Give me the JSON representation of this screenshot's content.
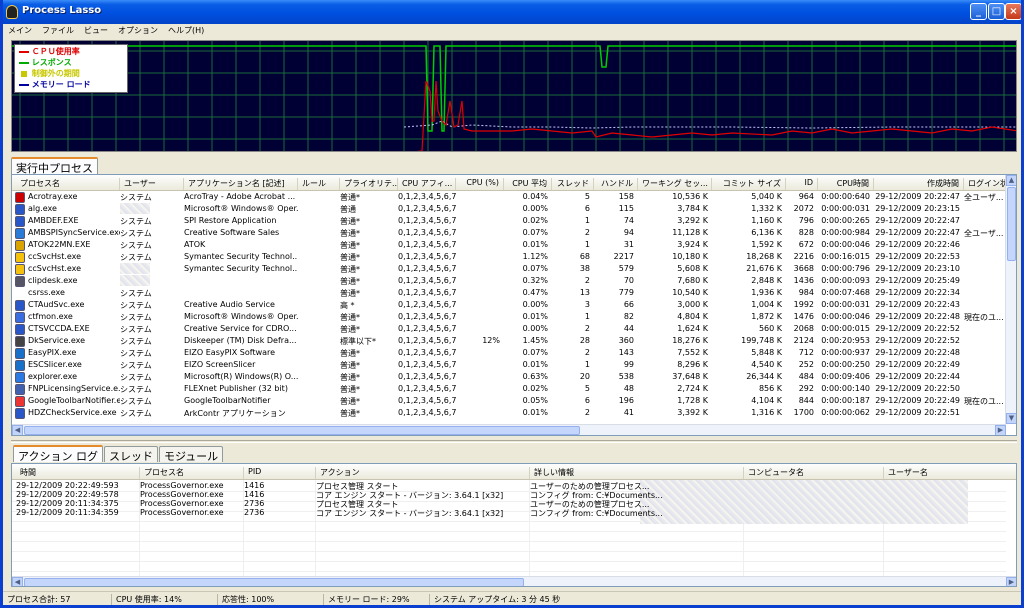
{
  "window": {
    "title": "Process Lasso"
  },
  "menu": [
    "メイン",
    "ファイル",
    "ビュー",
    "オプション",
    "ヘルプ(H)"
  ],
  "colors": {
    "cpu": "#e00000",
    "response": "#00cc00",
    "restraint": "#d0d000",
    "memory": "#3030ff",
    "graph_bg": "#000035",
    "grid": "#1a6a3a"
  },
  "graph": {
    "legend": [
      {
        "label": "ＣＰＵ使用率",
        "color": "#e00000",
        "icon": "solid-line-icon"
      },
      {
        "label": "レスポンス",
        "color": "#00aa00",
        "icon": "solid-line-icon"
      },
      {
        "label": "制御外の期間",
        "color": "#c8c800",
        "icon": "square-icon"
      },
      {
        "label": "メモリー ロード",
        "color": "#0000a0",
        "icon": "dashed-line-icon"
      }
    ]
  },
  "process_tab": "実行中プロセス",
  "process_columns": [
    "プロセス名",
    "ユーザー",
    "アプリケーション名 [記述]",
    "ルール",
    "プライオリテ...",
    "CPU アフィ...",
    "CPU (%)",
    "CPU 平均",
    "スレッド",
    "ハンドル",
    "ワーキング セッ...",
    "コミット サイズ",
    "ID",
    "CPU時間",
    "作成時間",
    "ログイン状"
  ],
  "processes": [
    {
      "name": "Acrotray.exe",
      "icon": "acrobat-icon",
      "user": "システム",
      "app": "AcroTray - Adobe Acrobat ...",
      "rule": "",
      "priority": "普通*",
      "affinity": "0,1,2,3,4,5,6,7",
      "cpu": "",
      "cpu_avg": "0.04%",
      "threads": "5",
      "handles": "158",
      "working_set": "10,536 K",
      "commit": "5,040 K",
      "id": "964",
      "cpu_time": "0:00:00:640",
      "created": "29-12/2009 20:22:47",
      "login": "全ユーザ..."
    },
    {
      "name": "alg.exe",
      "icon": "app-icon",
      "user": "",
      "app": "Microsoft® Windows® Oper...",
      "rule": "",
      "priority": "普通",
      "affinity": "0,1,2,3,4,5,6,7",
      "cpu": "",
      "cpu_avg": "0.00%",
      "threads": "6",
      "handles": "115",
      "working_set": "3,784 K",
      "commit": "1,332 K",
      "id": "2072",
      "cpu_time": "0:00:00:031",
      "created": "29-12/2009 20:23:15",
      "login": ""
    },
    {
      "name": "AMBDEF.EXE",
      "icon": "app-icon",
      "user": "システム",
      "app": "SPI Restore Application",
      "rule": "",
      "priority": "普通*",
      "affinity": "0,1,2,3,4,5,6,7",
      "cpu": "",
      "cpu_avg": "0.02%",
      "threads": "1",
      "handles": "74",
      "working_set": "3,292 K",
      "commit": "1,160 K",
      "id": "796",
      "cpu_time": "0:00:00:265",
      "created": "29-12/2009 20:22:47",
      "login": ""
    },
    {
      "name": "AMBSPISyncService.exe",
      "icon": "globe-icon",
      "user": "システム",
      "app": "Creative Software Sales",
      "rule": "",
      "priority": "普通*",
      "affinity": "0,1,2,3,4,5,6,7",
      "cpu": "",
      "cpu_avg": "0.07%",
      "threads": "2",
      "handles": "94",
      "working_set": "11,128 K",
      "commit": "6,136 K",
      "id": "828",
      "cpu_time": "0:00:00:984",
      "created": "29-12/2009 20:22:47",
      "login": "全ユーザ..."
    },
    {
      "name": "ATOK22MN.EXE",
      "icon": "atok-icon",
      "user": "システム",
      "app": "ATOK",
      "rule": "",
      "priority": "普通*",
      "affinity": "0,1,2,3,4,5,6,7",
      "cpu": "",
      "cpu_avg": "0.01%",
      "threads": "1",
      "handles": "31",
      "working_set": "3,924 K",
      "commit": "1,592 K",
      "id": "672",
      "cpu_time": "0:00:00:046",
      "created": "29-12/2009 20:22:46",
      "login": ""
    },
    {
      "name": "ccSvcHst.exe",
      "icon": "norton-icon",
      "user": "システム",
      "app": "Symantec Security Technol...",
      "rule": "",
      "priority": "普通*",
      "affinity": "0,1,2,3,4,5,6,7",
      "cpu": "",
      "cpu_avg": "1.12%",
      "threads": "68",
      "handles": "2217",
      "working_set": "10,180 K",
      "commit": "18,268 K",
      "id": "2216",
      "cpu_time": "0:00:16:015",
      "created": "29-12/2009 20:22:53",
      "login": ""
    },
    {
      "name": "ccSvcHst.exe",
      "icon": "norton-icon",
      "user": "",
      "app": "Symantec Security Technol...",
      "rule": "",
      "priority": "普通*",
      "affinity": "0,1,2,3,4,5,6,7",
      "cpu": "",
      "cpu_avg": "0.07%",
      "threads": "38",
      "handles": "579",
      "working_set": "5,608 K",
      "commit": "21,676 K",
      "id": "3668",
      "cpu_time": "0:00:00:796",
      "created": "29-12/2009 20:23:10",
      "login": ""
    },
    {
      "name": "clipdesk.exe",
      "icon": "clip-icon",
      "user": "",
      "app": "",
      "rule": "",
      "priority": "普通*",
      "affinity": "0,1,2,3,4,5,6,7",
      "cpu": "",
      "cpu_avg": "0.32%",
      "threads": "2",
      "handles": "70",
      "working_set": "7,680 K",
      "commit": "2,848 K",
      "id": "1436",
      "cpu_time": "0:00:00:093",
      "created": "29-12/2009 20:25:49",
      "login": ""
    },
    {
      "name": "csrss.exe",
      "icon": "blank-icon",
      "user": "システム",
      "app": "",
      "rule": "",
      "priority": "普通*",
      "affinity": "0,1,2,3,4,5,6,7",
      "cpu": "",
      "cpu_avg": "0.47%",
      "threads": "13",
      "handles": "779",
      "working_set": "10,540 K",
      "commit": "1,936 K",
      "id": "984",
      "cpu_time": "0:00:07:468",
      "created": "29-12/2009 20:22:34",
      "login": ""
    },
    {
      "name": "CTAudSvc.exe",
      "icon": "app-icon",
      "user": "システム",
      "app": "Creative Audio Service",
      "rule": "",
      "priority": "高 *",
      "affinity": "0,1,2,3,4,5,6,7",
      "cpu": "",
      "cpu_avg": "0.00%",
      "threads": "3",
      "handles": "66",
      "working_set": "3,000 K",
      "commit": "1,004 K",
      "id": "1992",
      "cpu_time": "0:00:00:031",
      "created": "29-12/2009 20:22:43",
      "login": ""
    },
    {
      "name": "ctfmon.exe",
      "icon": "ctf-icon",
      "user": "システム",
      "app": "Microsoft® Windows® Oper...",
      "rule": "",
      "priority": "普通*",
      "affinity": "0,1,2,3,4,5,6,7",
      "cpu": "",
      "cpu_avg": "0.01%",
      "threads": "1",
      "handles": "82",
      "working_set": "4,804 K",
      "commit": "1,872 K",
      "id": "1476",
      "cpu_time": "0:00:00:046",
      "created": "29-12/2009 20:22:48",
      "login": "現在のユ..."
    },
    {
      "name": "CTSVCCDA.EXE",
      "icon": "app-icon",
      "user": "システム",
      "app": "Creative Service for CDRO...",
      "rule": "",
      "priority": "普通*",
      "affinity": "0,1,2,3,4,5,6,7",
      "cpu": "",
      "cpu_avg": "0.00%",
      "threads": "2",
      "handles": "44",
      "working_set": "1,624 K",
      "commit": "560 K",
      "id": "2068",
      "cpu_time": "0:00:00:015",
      "created": "29-12/2009 20:22:52",
      "login": ""
    },
    {
      "name": "DkService.exe",
      "icon": "clock-icon",
      "user": "システム",
      "app": "Diskeeper (TM) Disk Defra...",
      "rule": "",
      "priority": "標準以下*",
      "affinity": "0,1,2,3,4,5,6,7",
      "cpu": "12%",
      "cpu_avg": "1.45%",
      "threads": "28",
      "handles": "360",
      "working_set": "18,276 K",
      "commit": "199,748 K",
      "id": "2124",
      "cpu_time": "0:00:20:953",
      "created": "29-12/2009 20:22:52",
      "login": ""
    },
    {
      "name": "EasyPIX.exe",
      "icon": "eizo-icon",
      "user": "システム",
      "app": "EIZO EasyPIX Software",
      "rule": "",
      "priority": "普通*",
      "affinity": "0,1,2,3,4,5,6,7",
      "cpu": "",
      "cpu_avg": "0.07%",
      "threads": "2",
      "handles": "143",
      "working_set": "7,552 K",
      "commit": "5,848 K",
      "id": "712",
      "cpu_time": "0:00:00:937",
      "created": "29-12/2009 20:22:48",
      "login": ""
    },
    {
      "name": "ESCSlicer.exe",
      "icon": "eizo-icon",
      "user": "システム",
      "app": "EIZO ScreenSlicer",
      "rule": "",
      "priority": "普通*",
      "affinity": "0,1,2,3,4,5,6,7",
      "cpu": "",
      "cpu_avg": "0.01%",
      "threads": "1",
      "handles": "99",
      "working_set": "8,296 K",
      "commit": "4,540 K",
      "id": "252",
      "cpu_time": "0:00:00:250",
      "created": "29-12/2009 20:22:49",
      "login": ""
    },
    {
      "name": "explorer.exe",
      "icon": "explorer-icon",
      "user": "システム",
      "app": "Microsoft(R) Windows(R) O...",
      "rule": "",
      "priority": "普通*",
      "affinity": "0,1,2,3,4,5,6,7",
      "cpu": "",
      "cpu_avg": "0.63%",
      "threads": "20",
      "handles": "538",
      "working_set": "37,648 K",
      "commit": "26,344 K",
      "id": "484",
      "cpu_time": "0:00:09:406",
      "created": "29-12/2009 20:22:44",
      "login": ""
    },
    {
      "name": "FNPLicensingService.e...",
      "icon": "license-icon",
      "user": "システム",
      "app": "FLEXnet Publisher (32 bit)",
      "rule": "",
      "priority": "普通*",
      "affinity": "0,1,2,3,4,5,6,7",
      "cpu": "",
      "cpu_avg": "0.02%",
      "threads": "5",
      "handles": "48",
      "working_set": "2,724 K",
      "commit": "856 K",
      "id": "292",
      "cpu_time": "0:00:00:140",
      "created": "29-12/2009 20:22:50",
      "login": ""
    },
    {
      "name": "GoogleToolbarNotifier.e...",
      "icon": "google-icon",
      "user": "システム",
      "app": "GoogleToolbarNotifier",
      "rule": "",
      "priority": "普通*",
      "affinity": "0,1,2,3,4,5,6,7",
      "cpu": "",
      "cpu_avg": "0.05%",
      "threads": "6",
      "handles": "196",
      "working_set": "1,728 K",
      "commit": "4,104 K",
      "id": "844",
      "cpu_time": "0:00:00:187",
      "created": "29-12/2009 20:22:49",
      "login": "現在のユ..."
    },
    {
      "name": "HDZCheckService.exe",
      "icon": "app-icon",
      "user": "システム",
      "app": "ArkContr アプリケーション",
      "rule": "",
      "priority": "普通*",
      "affinity": "0,1,2,3,4,5,6,7",
      "cpu": "",
      "cpu_avg": "0.01%",
      "threads": "2",
      "handles": "41",
      "working_set": "3,392 K",
      "commit": "1,316 K",
      "id": "1700",
      "cpu_time": "0:00:00:062",
      "created": "29-12/2009 20:22:51",
      "login": ""
    }
  ],
  "bottom_tabs": [
    "アクション ログ",
    "スレッド",
    "モジュール"
  ],
  "log_columns": [
    "時間",
    "プロセス名",
    "PID",
    "アクション",
    "詳しい情報",
    "コンピュータ名",
    "ユーザー名"
  ],
  "log_rows": [
    {
      "time": "29-12/2009 20:22:49:593",
      "process": "ProcessGovernor.exe",
      "pid": "1416",
      "action": "プロセス管理 スタート",
      "detail": "ユーザーのための管理プロセス..."
    },
    {
      "time": "29-12/2009 20:22:49:578",
      "process": "ProcessGovernor.exe",
      "pid": "1416",
      "action": "コア エンジン スタート - バージョン: 3.64.1 [x32]",
      "detail": "コンフィグ from: C:¥Documents..."
    },
    {
      "time": "29-12/2009 20:11:34:375",
      "process": "ProcessGovernor.exe",
      "pid": "2736",
      "action": "プロセス管理 スタート",
      "detail": "ユーザーのための管理プロセス..."
    },
    {
      "time": "29-12/2009 20:11:34:359",
      "process": "ProcessGovernor.exe",
      "pid": "2736",
      "action": "コア エンジン スタート - バージョン: 3.64.1 [x32]",
      "detail": "コンフィグ from: C:¥Documents..."
    }
  ],
  "status": {
    "process_total": "プロセス合計: 57",
    "cpu_usage": "CPU 使用率: 14%",
    "response": "応答性: 100%",
    "memory_load": "メモリー ロード: 29%",
    "uptime": "システム アップタイム: 3 分 45 秒"
  }
}
